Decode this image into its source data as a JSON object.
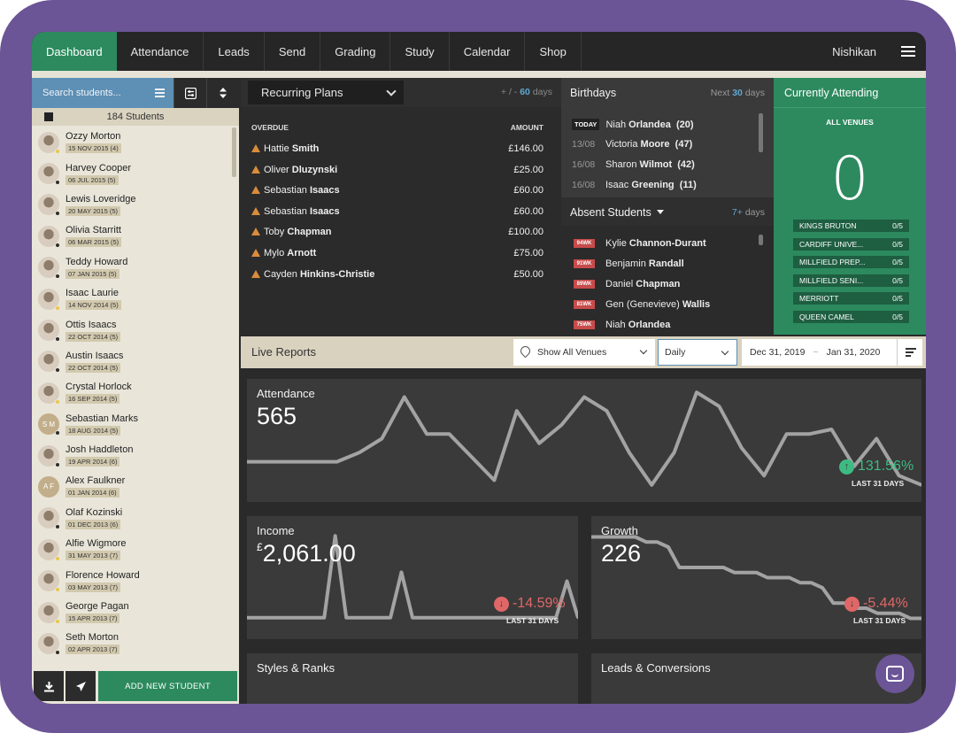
{
  "nav": {
    "items": [
      "Dashboard",
      "Attendance",
      "Leads",
      "Send",
      "Grading",
      "Study",
      "Calendar",
      "Shop"
    ],
    "active": "Dashboard",
    "user": "Nishikan"
  },
  "sidebar": {
    "search_placeholder": "Search students...",
    "count_label": "184 Students",
    "add_button": "ADD NEW STUDENT",
    "students": [
      {
        "first": "Ozzy",
        "last": "Morton",
        "date": "15 NOV 2015 (4)",
        "avatar": "photo",
        "dot": "yellow"
      },
      {
        "first": "Harvey",
        "last": "Cooper",
        "date": "06 JUL 2015 (5)",
        "avatar": "photo",
        "dot": "dark"
      },
      {
        "first": "Lewis",
        "last": "Loveridge",
        "date": "20 MAY 2015 (5)",
        "avatar": "photo",
        "dot": "dark"
      },
      {
        "first": "Olivia",
        "last": "Starritt",
        "date": "06 MAR 2015 (5)",
        "avatar": "photo",
        "dot": "dark"
      },
      {
        "first": "Teddy",
        "last": "Howard",
        "date": "07 JAN 2015 (5)",
        "avatar": "photo",
        "dot": "dark"
      },
      {
        "first": "Isaac",
        "last": "Laurie",
        "date": "14 NOV 2014 (5)",
        "avatar": "photo",
        "dot": "yellow"
      },
      {
        "first": "Ottis",
        "last": "Isaacs",
        "date": "22 OCT 2014 (5)",
        "avatar": "photo",
        "dot": "dark"
      },
      {
        "first": "Austin",
        "last": "Isaacs",
        "date": "22 OCT 2014 (5)",
        "avatar": "photo",
        "dot": "dark"
      },
      {
        "first": "Crystal",
        "last": "Horlock",
        "date": "16 SEP 2014 (5)",
        "avatar": "photo",
        "dot": "yellow"
      },
      {
        "first": "Sebastian",
        "last": "Marks",
        "date": "18 AUG 2014 (5)",
        "avatar": "initials",
        "initials": "S M",
        "dot": "dark"
      },
      {
        "first": "Josh",
        "last": "Haddleton",
        "date": "19 APR 2014 (6)",
        "avatar": "photo",
        "dot": "dark"
      },
      {
        "first": "Alex",
        "last": "Faulkner",
        "date": "01 JAN 2014 (6)",
        "avatar": "initials",
        "initials": "A F",
        "dot": "none"
      },
      {
        "first": "Olaf",
        "last": "Kozinski",
        "date": "01 DEC 2013 (6)",
        "avatar": "photo",
        "dot": "dark"
      },
      {
        "first": "Alfie",
        "last": "Wigmore",
        "date": "31 MAY 2013 (7)",
        "avatar": "photo",
        "dot": "yellow"
      },
      {
        "first": "Florence",
        "last": "Howard",
        "date": "03 MAY 2013 (7)",
        "avatar": "photo",
        "dot": "yellow"
      },
      {
        "first": "George",
        "last": "Pagan",
        "date": "15 APR 2013 (7)",
        "avatar": "photo",
        "dot": "yellow"
      },
      {
        "first": "Seth",
        "last": "Morton",
        "date": "02 APR 2013 (7)",
        "avatar": "photo",
        "dot": "dark"
      }
    ]
  },
  "plans": {
    "select_label": "Recurring Plans",
    "range_prefix": "+ / -",
    "range_value": "60",
    "range_suffix": "days",
    "col_overdue": "OVERDUE",
    "col_amount": "AMOUNT",
    "rows": [
      {
        "first": "Hattie",
        "last": "Smith",
        "amount": "£146.00"
      },
      {
        "first": "Oliver",
        "last": "Dluzynski",
        "amount": "£25.00"
      },
      {
        "first": "Sebastian",
        "last": "Isaacs",
        "amount": "£60.00"
      },
      {
        "first": "Sebastian",
        "last": "Isaacs",
        "amount": "£60.00"
      },
      {
        "first": "Toby",
        "last": "Chapman",
        "amount": "£100.00"
      },
      {
        "first": "Mylo",
        "last": "Arnott",
        "amount": "£75.00"
      },
      {
        "first": "Cayden",
        "last": "Hinkins-Christie",
        "amount": "£50.00"
      }
    ]
  },
  "birthdays": {
    "title": "Birthdays",
    "next_prefix": "Next",
    "next_value": "30",
    "next_suffix": "days",
    "rows": [
      {
        "date": "TODAY",
        "today": true,
        "first": "Niah",
        "last": "Orlandea",
        "age": "(20)"
      },
      {
        "date": "13/08",
        "today": false,
        "first": "Victoria",
        "last": "Moore",
        "age": "(47)"
      },
      {
        "date": "16/08",
        "today": false,
        "first": "Sharon",
        "last": "Wilmot",
        "age": "(42)"
      },
      {
        "date": "16/08",
        "today": false,
        "first": "Isaac",
        "last": "Greening",
        "age": "(11)"
      }
    ]
  },
  "absent": {
    "title": "Absent Students",
    "days_value": "7+",
    "days_suffix": "days",
    "rows": [
      {
        "wk": "94WK",
        "first": "Kylie",
        "last": "Channon-Durant"
      },
      {
        "wk": "91WK",
        "first": "Benjamin",
        "last": "Randall"
      },
      {
        "wk": "89WK",
        "first": "Daniel",
        "last": "Chapman"
      },
      {
        "wk": "81WK",
        "first": "Gen (Genevieve)",
        "last": "Wallis"
      },
      {
        "wk": "75WK",
        "first": "Niah",
        "last": "Orlandea"
      }
    ]
  },
  "attending": {
    "title": "Currently Attending",
    "all_venues": "ALL VENUES",
    "count": "0",
    "venues": [
      {
        "name": "KINGS BRUTON",
        "value": "0/5"
      },
      {
        "name": "CARDIFF UNIVE...",
        "value": "0/5"
      },
      {
        "name": "MILLFIELD PREP...",
        "value": "0/5"
      },
      {
        "name": "MILLFIELD SENI...",
        "value": "0/5"
      },
      {
        "name": "MERRIOTT",
        "value": "0/5"
      },
      {
        "name": "QUEEN CAMEL",
        "value": "0/5"
      }
    ]
  },
  "live": {
    "title": "Live Reports",
    "venue_select": "Show All Venues",
    "period_select": "Daily",
    "date_from": "Dec 31, 2019",
    "date_to": "Jan 31, 2020",
    "tilde": "~"
  },
  "colors": {
    "accent_green": "#2c8a5e",
    "accent_blue": "#5fa8d3",
    "up_green": "#3dbb82",
    "down_red": "#e06767",
    "frame_purple": "#6b5596"
  },
  "chart_data": [
    {
      "type": "line",
      "title": "Attendance",
      "value": "565",
      "change": "131.56%",
      "direction": "up",
      "period": "LAST 31 DAYS",
      "x": [
        1,
        2,
        3,
        4,
        5,
        6,
        7,
        8,
        9,
        10,
        11,
        12,
        13,
        14,
        15,
        16,
        17,
        18,
        19,
        20,
        21,
        22,
        23,
        24,
        25,
        26,
        27,
        28,
        29,
        30,
        31
      ],
      "values": [
        6,
        6,
        6,
        6,
        6,
        8,
        11,
        20,
        12,
        12,
        7,
        2,
        17,
        10,
        14,
        20,
        17,
        8,
        1,
        8,
        21,
        18,
        9,
        3,
        12,
        12,
        13,
        5,
        11,
        3,
        1
      ],
      "ylim": [
        0,
        22
      ]
    },
    {
      "type": "line",
      "title": "Income",
      "value_prefix": "£",
      "value": "2,061.00",
      "change": "-14.59%",
      "direction": "down",
      "period": "LAST 31 DAYS",
      "x": [
        1,
        2,
        3,
        4,
        5,
        6,
        7,
        8,
        9,
        10,
        11,
        12,
        13,
        14,
        15,
        16,
        17,
        18,
        19,
        20,
        21,
        22,
        23,
        24,
        25,
        26,
        27,
        28,
        29,
        30,
        31
      ],
      "values": [
        1,
        1,
        1,
        1,
        1,
        1,
        1,
        1,
        10,
        1,
        1,
        1,
        1,
        1,
        6,
        1,
        1,
        1,
        1,
        1,
        1,
        1,
        1,
        1,
        1,
        1,
        1,
        1,
        1,
        5,
        1
      ],
      "ylim": [
        0,
        11
      ]
    },
    {
      "type": "line",
      "title": "Growth",
      "value": "226",
      "change": "-5.44%",
      "direction": "down",
      "period": "LAST 31 DAYS",
      "x": [
        1,
        2,
        3,
        4,
        5,
        6,
        7,
        8,
        9,
        10,
        11,
        12,
        13,
        14,
        15,
        16,
        17,
        18,
        19,
        20,
        21,
        22,
        23,
        24,
        25,
        26,
        27,
        28,
        29,
        30,
        31
      ],
      "values": [
        240,
        240,
        240,
        240,
        240,
        239,
        239,
        238,
        234,
        234,
        234,
        234,
        234,
        233,
        233,
        233,
        232,
        232,
        232,
        231,
        231,
        230,
        227,
        227,
        226,
        226,
        225,
        225,
        225,
        224,
        224
      ],
      "ylim": [
        222,
        242
      ]
    },
    {
      "type": "line",
      "title": "Styles & Ranks"
    },
    {
      "type": "line",
      "title": "Leads & Conversions"
    }
  ]
}
